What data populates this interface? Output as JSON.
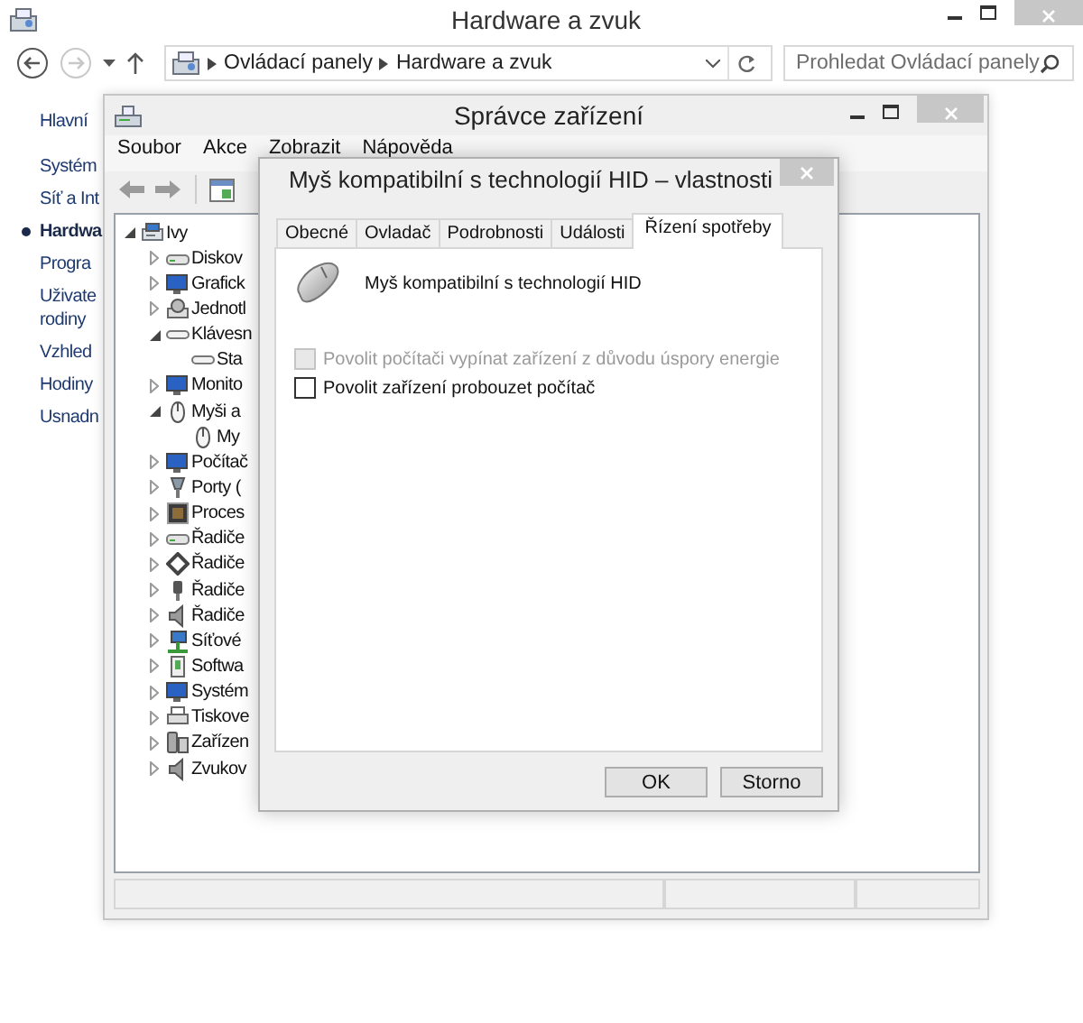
{
  "main_window": {
    "title": "Hardware a zvuk",
    "address": {
      "path": [
        "Ovládací panely",
        "Hardware a zvuk"
      ]
    },
    "search": {
      "placeholder": "Prohledat Ovládací panely"
    },
    "nav": [
      {
        "label": "Hlavní",
        "selected": false
      },
      {
        "label": "Systém",
        "selected": false
      },
      {
        "label": "Síť a Int",
        "selected": false
      },
      {
        "label": "Hardwa",
        "selected": true
      },
      {
        "label": "Progra",
        "selected": false
      },
      {
        "label": "Uživate\nrodiny",
        "selected": false
      },
      {
        "label": "Vzhled",
        "selected": false
      },
      {
        "label": "Hodiny",
        "selected": false
      },
      {
        "label": "Usnadn",
        "selected": false
      }
    ]
  },
  "device_manager": {
    "title": "Správce zařízení",
    "menu": [
      "Soubor",
      "Akce",
      "Zobrazit",
      "Nápověda"
    ],
    "tree": [
      {
        "label": "Ivy",
        "expanded": true,
        "children": [
          {
            "label": "Diskov",
            "expanded": false
          },
          {
            "label": "Grafick",
            "expanded": false
          },
          {
            "label": "Jednotl",
            "expanded": false
          },
          {
            "label": "Klávesn",
            "expanded": true,
            "children": [
              {
                "label": "Sta"
              }
            ]
          },
          {
            "label": "Monito",
            "expanded": false
          },
          {
            "label": "Myši a",
            "expanded": true,
            "children": [
              {
                "label": "My"
              }
            ]
          },
          {
            "label": "Počítač",
            "expanded": false
          },
          {
            "label": "Porty (",
            "expanded": false
          },
          {
            "label": "Proces",
            "expanded": false
          },
          {
            "label": "Řadiče",
            "expanded": false
          },
          {
            "label": "Řadiče",
            "expanded": false
          },
          {
            "label": "Řadiče",
            "expanded": false
          },
          {
            "label": "Řadiče",
            "expanded": false
          },
          {
            "label": "Síťové",
            "expanded": false
          },
          {
            "label": "Softwa",
            "expanded": false
          },
          {
            "label": "Systém",
            "expanded": false
          },
          {
            "label": "Tiskove",
            "expanded": false
          },
          {
            "label": "Zařízen",
            "expanded": false
          },
          {
            "label": "Zvukov",
            "expanded": false
          }
        ]
      }
    ]
  },
  "dialog": {
    "title": "Myš kompatibilní s technologií HID – vlastnosti",
    "tabs": [
      {
        "label": "Obecné",
        "selected": false
      },
      {
        "label": "Ovladač",
        "selected": false
      },
      {
        "label": "Podrobnosti",
        "selected": false
      },
      {
        "label": "Události",
        "selected": false
      },
      {
        "label": "Řízení spotřeby",
        "selected": true
      }
    ],
    "device_name": "Myš kompatibilní s technologií HID",
    "options": [
      {
        "label": "Povolit počítači vypínat zařízení z důvodu úspory energie",
        "checked": false,
        "disabled": true
      },
      {
        "label": "Povolit zařízení probouzet počítač",
        "checked": false,
        "disabled": false
      }
    ],
    "buttons": [
      "OK",
      "Storno"
    ]
  }
}
